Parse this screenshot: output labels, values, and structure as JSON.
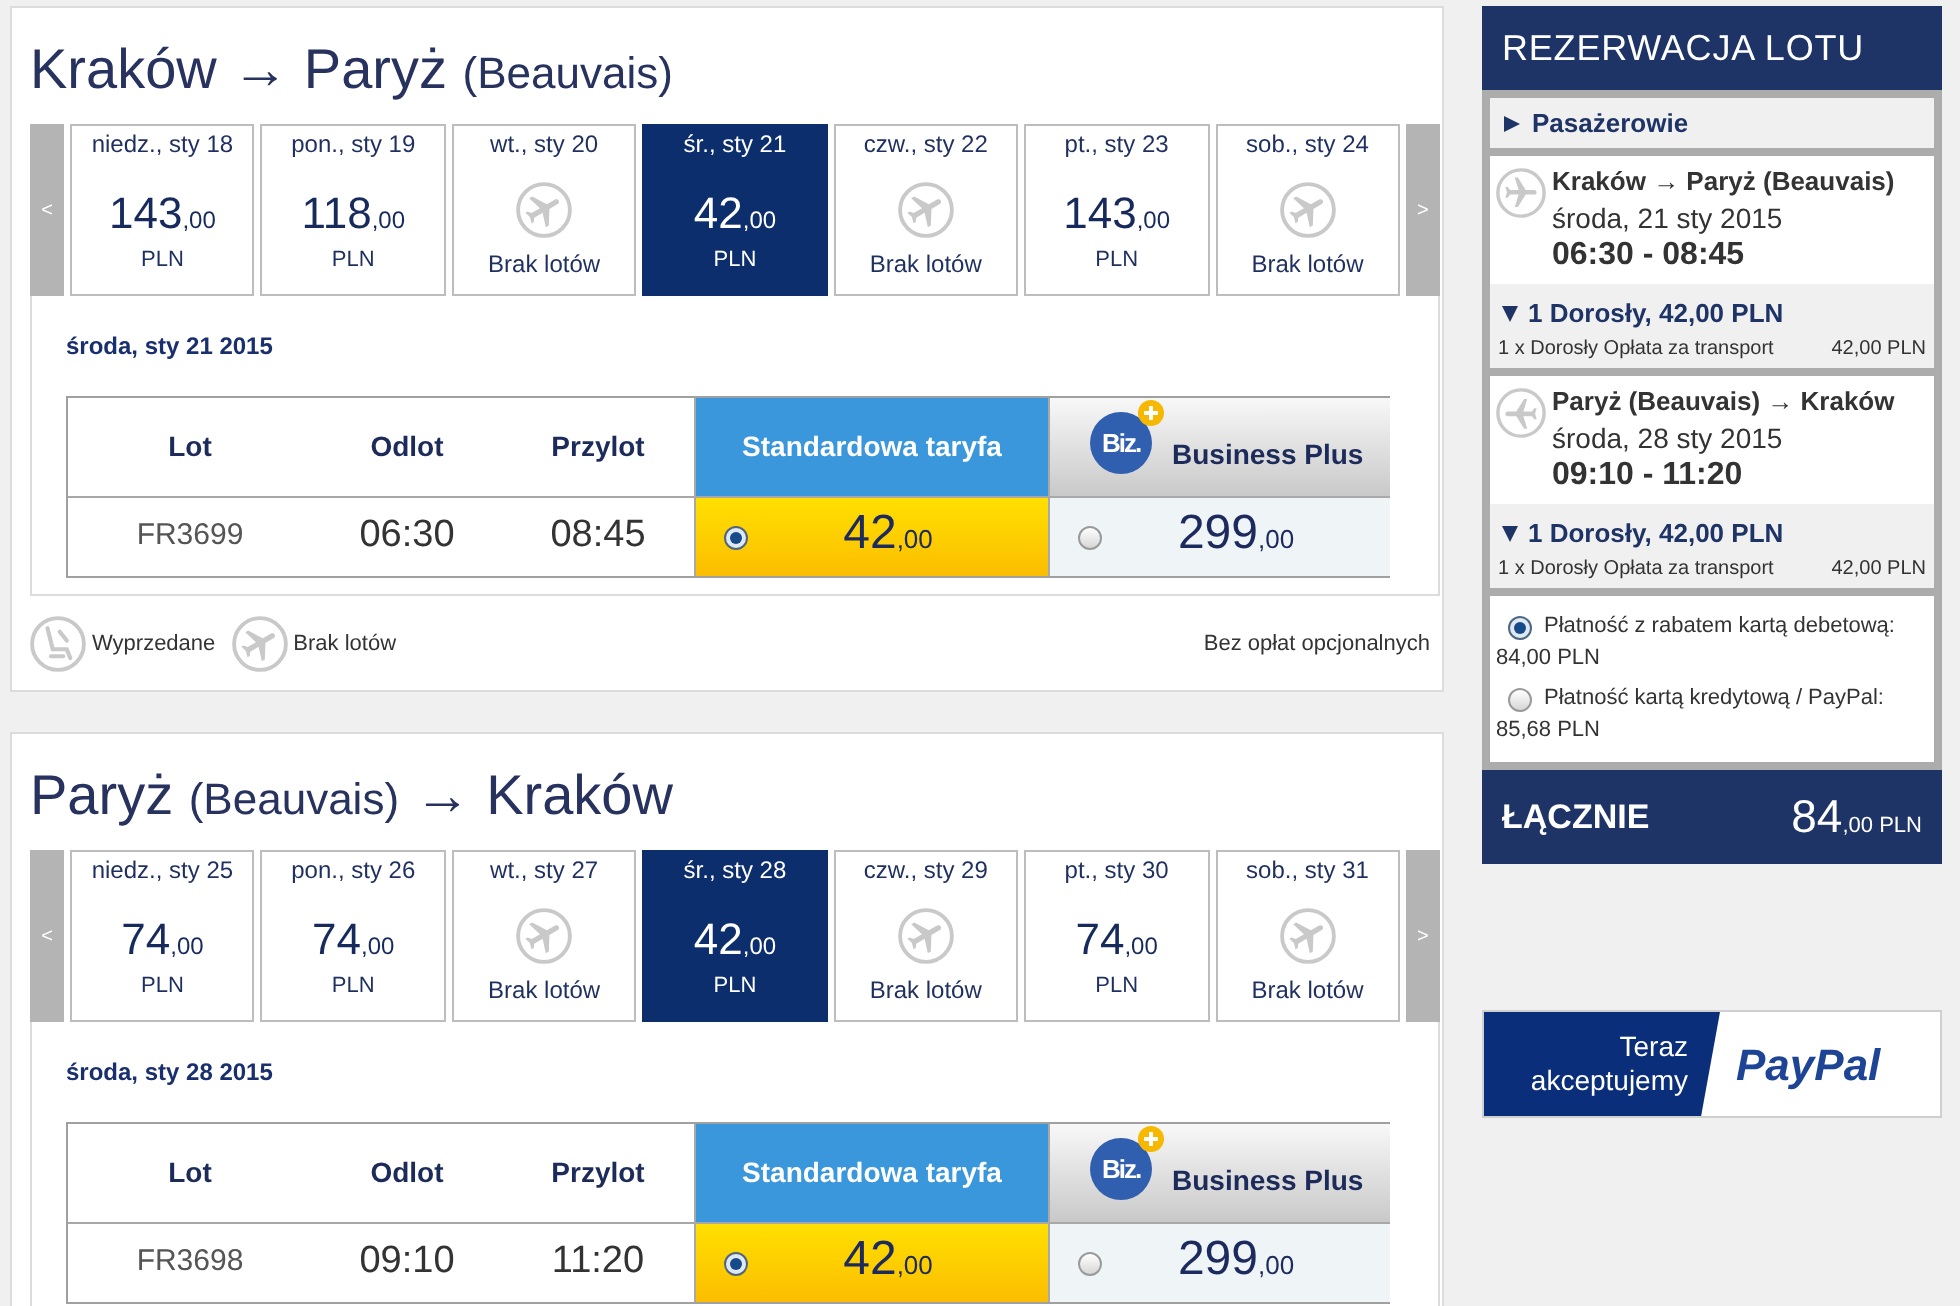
{
  "flights": [
    {
      "title": [
        {
          "text": "Kraków → Paryż",
          "kind": "city"
        },
        {
          "text": "(Beauvais)",
          "kind": "airport"
        }
      ],
      "prev": "<",
      "next": ">",
      "dates": [
        {
          "day": "niedz., sty 18",
          "kind": "fare",
          "price": "143",
          "decimals": ",00",
          "currency": "PLN",
          "selected": false
        },
        {
          "day": "pon., sty 19",
          "kind": "fare",
          "price": "118",
          "decimals": ",00",
          "currency": "PLN",
          "selected": false
        },
        {
          "day": "wt., sty 20",
          "kind": "none",
          "note": "Brak lotów",
          "selected": false
        },
        {
          "day": "śr., sty 21",
          "kind": "fare",
          "price": "42",
          "decimals": ",00",
          "currency": "PLN",
          "selected": true
        },
        {
          "day": "czw., sty 22",
          "kind": "none",
          "note": "Brak lotów",
          "selected": false
        },
        {
          "day": "pt., sty 23",
          "kind": "fare",
          "price": "143",
          "decimals": ",00",
          "currency": "PLN",
          "selected": false
        },
        {
          "day": "sob., sty 24",
          "kind": "none",
          "note": "Brak lotów",
          "selected": false
        }
      ],
      "date_heading": "środa, sty 21 2015",
      "table": {
        "columns": [
          {
            "label": "Lot",
            "kind": "plain"
          },
          {
            "label": "Odlot",
            "kind": "plain"
          },
          {
            "label": "Przylot",
            "kind": "plain"
          },
          {
            "label": "Standardowa taryfa",
            "kind": "standard"
          },
          {
            "label": "Business Plus",
            "kind": "business",
            "badge": "Biz."
          }
        ],
        "rows": [
          {
            "flight": "FR3699",
            "departure": "06:30",
            "arrival": "08:45",
            "fares": [
              {
                "price": "42",
                "decimals": ",00",
                "selected": true
              },
              {
                "price": "299",
                "decimals": ",00",
                "selected": false
              }
            ]
          }
        ]
      },
      "legend": [
        {
          "kind": "sold_out",
          "label": "Wyprzedane"
        },
        {
          "kind": "none",
          "label": "Brak lotów"
        }
      ],
      "note": "Bez opłat opcjonalnych"
    },
    {
      "title": [
        {
          "text": "Paryż",
          "kind": "city"
        },
        {
          "text": "(Beauvais)",
          "kind": "airport"
        },
        {
          "text": "→ Kraków",
          "kind": "city"
        }
      ],
      "prev": "<",
      "next": ">",
      "dates": [
        {
          "day": "niedz., sty 25",
          "kind": "fare",
          "price": "74",
          "decimals": ",00",
          "currency": "PLN",
          "selected": false
        },
        {
          "day": "pon., sty 26",
          "kind": "fare",
          "price": "74",
          "decimals": ",00",
          "currency": "PLN",
          "selected": false
        },
        {
          "day": "wt., sty 27",
          "kind": "none",
          "note": "Brak lotów",
          "selected": false
        },
        {
          "day": "śr., sty 28",
          "kind": "fare",
          "price": "42",
          "decimals": ",00",
          "currency": "PLN",
          "selected": true
        },
        {
          "day": "czw., sty 29",
          "kind": "none",
          "note": "Brak lotów",
          "selected": false
        },
        {
          "day": "pt., sty 30",
          "kind": "fare",
          "price": "74",
          "decimals": ",00",
          "currency": "PLN",
          "selected": false
        },
        {
          "day": "sob., sty 31",
          "kind": "none",
          "note": "Brak lotów",
          "selected": false
        }
      ],
      "date_heading": "środa, sty 28 2015",
      "table": {
        "columns": [
          {
            "label": "Lot",
            "kind": "plain"
          },
          {
            "label": "Odlot",
            "kind": "plain"
          },
          {
            "label": "Przylot",
            "kind": "plain"
          },
          {
            "label": "Standardowa taryfa",
            "kind": "standard"
          },
          {
            "label": "Business Plus",
            "kind": "business",
            "badge": "Biz."
          }
        ],
        "rows": [
          {
            "flight": "FR3698",
            "departure": "09:10",
            "arrival": "11:20",
            "fares": [
              {
                "price": "42",
                "decimals": ",00",
                "selected": true
              },
              {
                "price": "299",
                "decimals": ",00",
                "selected": false
              }
            ]
          }
        ]
      }
    }
  ],
  "booking": {
    "title": "REZERWACJA LOTU",
    "passengers": {
      "label": "Pasażerowie",
      "expanded": false
    },
    "flights": [
      {
        "kind": "outbound",
        "route": "Kraków → Paryż (Beauvais)",
        "date": "środa, 21 sty 2015",
        "time": "06:30 - 08:45",
        "summary": {
          "label": "1 Dorosły, 42,00 PLN",
          "expanded": true
        },
        "fees": [
          {
            "label": "1 x Dorosły Opłata za transport",
            "amount": "42,00 PLN"
          }
        ]
      },
      {
        "kind": "return",
        "route": "Paryż (Beauvais) → Kraków",
        "date": "środa, 28 sty 2015",
        "time": "09:10 - 11:20",
        "summary": {
          "label": "1 Dorosły, 42,00 PLN",
          "expanded": true
        },
        "fees": [
          {
            "label": "1 x Dorosły Opłata za transport",
            "amount": "42,00 PLN"
          }
        ]
      }
    ],
    "payment_options": [
      {
        "label": "Płatność z rabatem kartą debetową:",
        "amount": "84,00 PLN",
        "selected": true
      },
      {
        "label": "Płatność kartą kredytową / PayPal:",
        "amount": "85,68 PLN",
        "selected": false
      }
    ],
    "total": {
      "label": "ŁĄCZNIE",
      "amount": "84",
      "decimals": ",00",
      "currency": "PLN"
    }
  },
  "paypal_banner": {
    "caption": "Teraz akceptujemy",
    "logo": "PayPal"
  }
}
